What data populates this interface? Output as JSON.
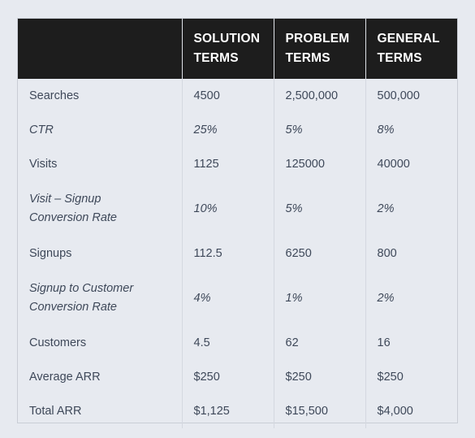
{
  "table": {
    "headers": [
      {
        "label": ""
      },
      {
        "label": "SOLUTION TERMS"
      },
      {
        "label": "PROBLEM TERMS"
      },
      {
        "label": "GENERAL TERMS"
      }
    ],
    "rows": [
      {
        "label": "Searches",
        "label_line2": "",
        "italic": false,
        "tall": false,
        "values": [
          "4500",
          "2,500,000",
          "500,000"
        ]
      },
      {
        "label": "CTR",
        "label_line2": "",
        "italic": true,
        "tall": false,
        "values": [
          "25%",
          "5%",
          "8%"
        ]
      },
      {
        "label": "Visits",
        "label_line2": "",
        "italic": false,
        "tall": false,
        "values": [
          "1125",
          "125000",
          "40000"
        ]
      },
      {
        "label": "Visit – Signup",
        "label_line2": "Conversion Rate",
        "italic": true,
        "tall": true,
        "values": [
          "10%",
          "5%",
          "2%"
        ]
      },
      {
        "label": "Signups",
        "label_line2": "",
        "italic": false,
        "tall": false,
        "values": [
          "112.5",
          "6250",
          "800"
        ]
      },
      {
        "label": "Signup to Customer",
        "label_line2": "Conversion Rate",
        "italic": true,
        "tall": true,
        "values": [
          "4%",
          "1%",
          "2%"
        ]
      },
      {
        "label": "Customers",
        "label_line2": "",
        "italic": false,
        "tall": false,
        "values": [
          "4.5",
          "62",
          "16"
        ]
      },
      {
        "label": "Average ARR",
        "label_line2": "",
        "italic": false,
        "tall": false,
        "values": [
          "$250",
          "$250",
          "$250"
        ]
      },
      {
        "label": "Total ARR",
        "label_line2": "",
        "italic": false,
        "tall": false,
        "values": [
          "$1,125",
          "$15,500",
          "$4,000"
        ]
      }
    ]
  },
  "colors": {
    "page_background": "#e7eaf0",
    "header_background": "#1d1d1d",
    "header_text": "#ffffff",
    "body_text": "#3e4859",
    "table_border": "#c9cdd5",
    "column_divider": "#d4d8e0"
  }
}
